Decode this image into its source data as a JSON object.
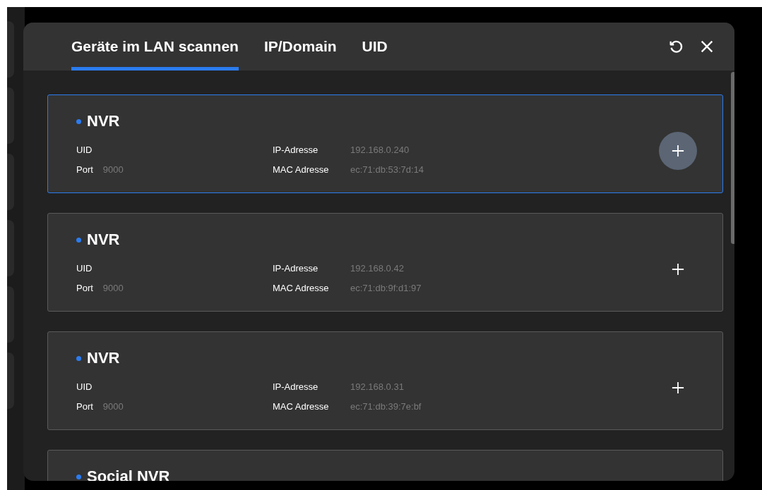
{
  "tabs": [
    {
      "label": "Geräte im LAN scannen",
      "selected": true
    },
    {
      "label": "IP/Domain",
      "selected": false
    },
    {
      "label": "UID",
      "selected": false
    }
  ],
  "devices": [
    {
      "name": "NVR",
      "selected": true,
      "uid_label": "UID",
      "port_label": "Port",
      "port": "9000",
      "ip_label": "IP-Adresse",
      "ip": "192.168.0.240",
      "mac_label": "MAC Adresse",
      "mac": "ec:71:db:53:7d:14"
    },
    {
      "name": "NVR",
      "selected": false,
      "uid_label": "UID",
      "port_label": "Port",
      "port": "9000",
      "ip_label": "IP-Adresse",
      "ip": "192.168.0.42",
      "mac_label": "MAC Adresse",
      "mac": "ec:71:db:9f:d1:97"
    },
    {
      "name": "NVR",
      "selected": false,
      "uid_label": "UID",
      "port_label": "Port",
      "port": "9000",
      "ip_label": "IP-Adresse",
      "ip": "192.168.0.31",
      "mac_label": "MAC Adresse",
      "mac": "ec:71:db:39:7e:bf"
    },
    {
      "name": "Social NVR",
      "selected": false
    }
  ]
}
